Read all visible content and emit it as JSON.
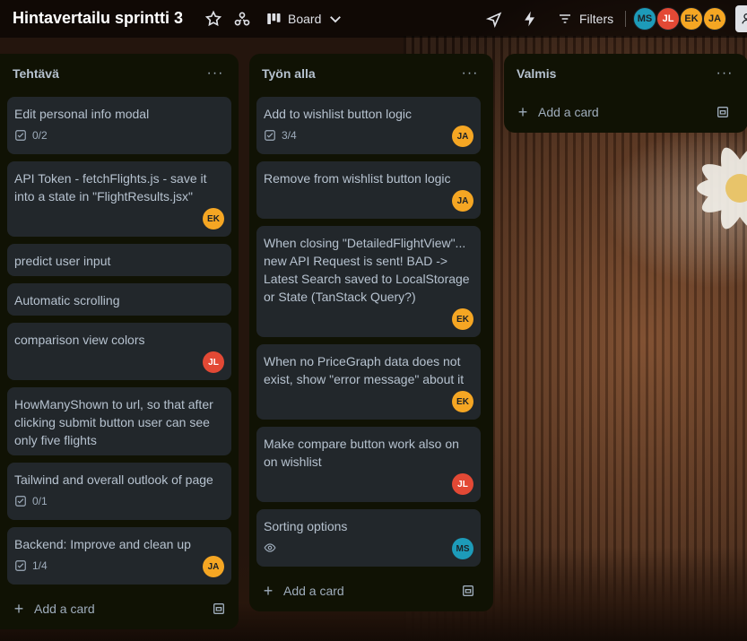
{
  "header": {
    "board_title": "Hintavertailu sprintti 3",
    "view_label": "Board",
    "filters_label": "Filters",
    "icons": [
      "star-icon",
      "workspace-icon",
      "board-view-icon",
      "chevron-down-icon",
      "power-ups-icon",
      "automation-icon",
      "filter-icon"
    ],
    "members": [
      {
        "initials": "MS",
        "color": "#1d9bb9"
      },
      {
        "initials": "JL",
        "color": "#e34935"
      },
      {
        "initials": "EK",
        "color": "#f5a623"
      },
      {
        "initials": "JA",
        "color": "#f5a623"
      }
    ]
  },
  "lists": [
    {
      "title": "Tehtävä",
      "menu": "···",
      "add_label": "Add a card",
      "cards": [
        {
          "title": "Edit personal info modal",
          "checklist": "0/2"
        },
        {
          "title": "API Token - fetchFlights.js - save it into a state in \"FlightResults.jsx\"",
          "member": "EK"
        },
        {
          "title": "predict user input"
        },
        {
          "title": "Automatic scrolling"
        },
        {
          "title": "comparison view colors",
          "member": "JL"
        },
        {
          "title": "HowManyShown to url, so that after clicking submit button user can see only five flights"
        },
        {
          "title": "Tailwind and overall outlook of page",
          "checklist": "0/1"
        },
        {
          "title": "Backend: Improve and clean up",
          "checklist": "1/4",
          "member": "JA"
        }
      ]
    },
    {
      "title": "Työn alla",
      "menu": "···",
      "add_label": "Add a card",
      "cards": [
        {
          "title": "Add to wishlist button logic",
          "checklist": "3/4",
          "member": "JA"
        },
        {
          "title": "Remove from wishlist button logic",
          "member": "JA"
        },
        {
          "title": "When closing \"DetailedFlightView\"... new API Request is sent! BAD -> Latest Search saved to LocalStorage or State (TanStack Query?)",
          "member": "EK"
        },
        {
          "title": "When no PriceGraph data does not exist, show \"error message\" about it",
          "member": "EK"
        },
        {
          "title": "Make compare button work also on on wishlist",
          "member": "JL"
        },
        {
          "title": "Sorting options",
          "watching": true,
          "member": "MS"
        }
      ]
    },
    {
      "title": "Valmis",
      "menu": "···",
      "add_label": "Add a card",
      "cards": []
    }
  ],
  "colors": {
    "list_bg": "#101204",
    "card_bg": "#22272b",
    "text": "#b6c2cf",
    "muted": "#9fadbc",
    "avatar_ms": "#1d9bb9",
    "avatar_jl": "#e34935",
    "avatar_ek_ja": "#f5a623"
  }
}
